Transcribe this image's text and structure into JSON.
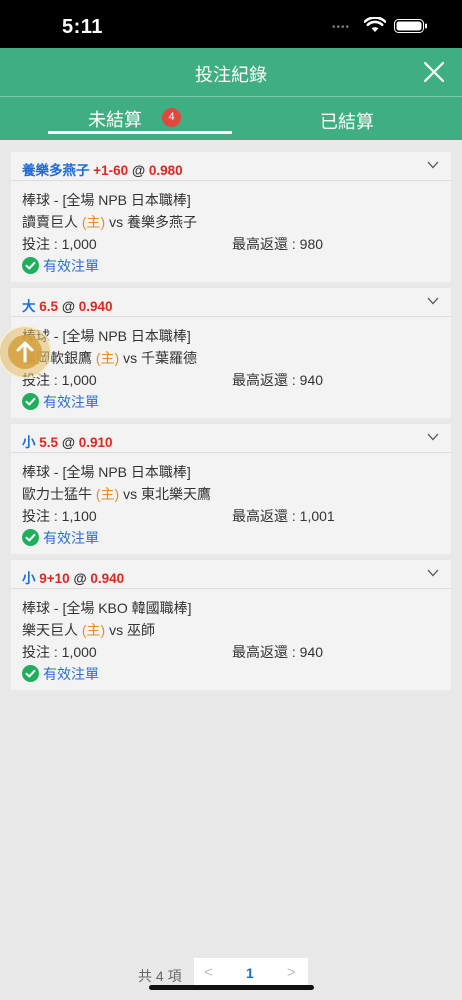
{
  "status": {
    "time": "5:11"
  },
  "header": {
    "title": "投注紀錄"
  },
  "tabs": {
    "open": {
      "label": "未結算",
      "badge": "4"
    },
    "settled": {
      "label": "已結算"
    }
  },
  "bets": [
    {
      "selection": "養樂多燕子",
      "selection_color": "blue",
      "handicap": "+1-60",
      "odds_sep": "@",
      "odds": "0.980",
      "sport_league": "棒球 - [全場 NPB 日本職棒]",
      "home_team": "讀賣巨人",
      "home_tag": "(主)",
      "vs": "vs",
      "away_team": "養樂多燕子",
      "stake": "投注 : 1,000",
      "max_return": "最高返還 : 980",
      "status": "有效注單"
    },
    {
      "selection": "大",
      "selection_color": "blue",
      "handicap": "6.5",
      "odds_sep": "@",
      "odds": "0.940",
      "sport_league": "棒球 - [全場 NPB 日本職棒]",
      "home_team": "福岡軟銀鷹",
      "home_tag": "(主)",
      "vs": "vs",
      "away_team": "千葉羅德",
      "stake": "投注 : 1,000",
      "max_return": "最高返還 : 940",
      "status": "有效注單"
    },
    {
      "selection": "小",
      "selection_color": "blue",
      "handicap": "5.5",
      "odds_sep": "@",
      "odds": "0.910",
      "sport_league": "棒球 - [全場 NPB 日本職棒]",
      "home_team": "歐力士猛牛",
      "home_tag": "(主)",
      "vs": "vs",
      "away_team": "東北樂天鷹",
      "stake": "投注 : 1,100",
      "max_return": "最高返還 : 1,001",
      "status": "有效注單"
    },
    {
      "selection": "小",
      "selection_color": "blue",
      "handicap": "9+10",
      "odds_sep": "@",
      "odds": "0.940",
      "sport_league": "棒球 - [全場 KBO 韓國職棒]",
      "home_team": "樂天巨人",
      "home_tag": "(主)",
      "vs": "vs",
      "away_team": "巫師",
      "stake": "投注 : 1,000",
      "max_return": "最高返還 : 940",
      "status": "有效注單"
    }
  ],
  "pager": {
    "count": "共 4 項",
    "prev": "<",
    "page": "1",
    "next": ">"
  },
  "colors": {
    "header_green": "#3fae82",
    "badge_red": "#e2473b",
    "selection_blue": "#1d6bd6",
    "odds_red": "#e0261f",
    "home_orange": "#e38e1f",
    "valid_green": "#1fae5b"
  }
}
